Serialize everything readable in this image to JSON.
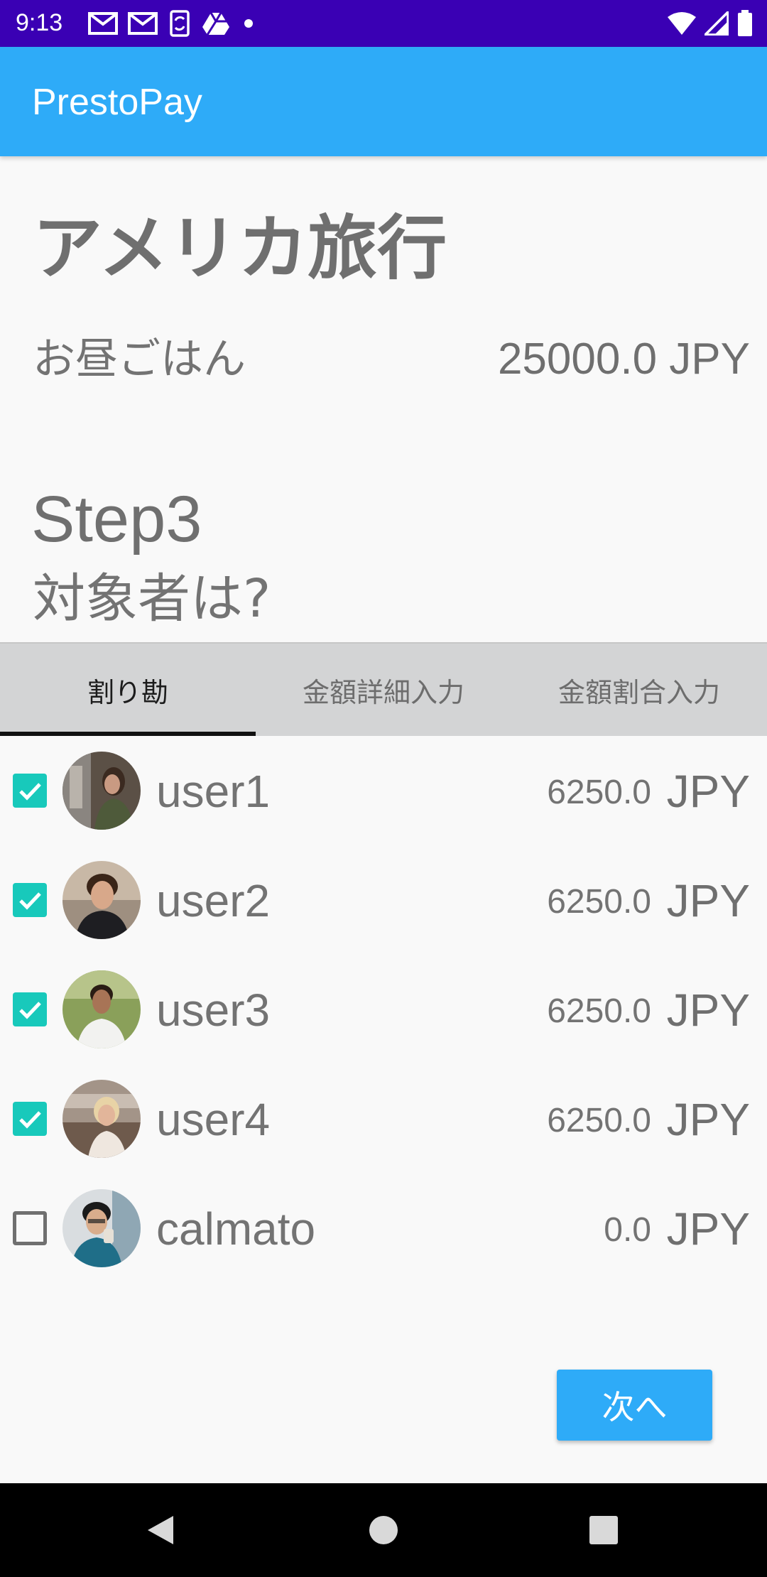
{
  "status_bar": {
    "time": "9:13",
    "left_icons": [
      "gmail-icon",
      "gmail-icon",
      "sync-icon",
      "drive-icon",
      "dot-icon"
    ],
    "right_icons": [
      "wifi-icon",
      "signal-icon",
      "battery-icon"
    ]
  },
  "app_bar": {
    "title": "PrestoPay"
  },
  "trip": {
    "title": "アメリカ旅行"
  },
  "expense": {
    "name": "お昼ごはん",
    "amount": "25000.0 JPY"
  },
  "step": {
    "label": "Step3",
    "question": "対象者は?"
  },
  "tabs": [
    {
      "label": "割り勘",
      "active": true
    },
    {
      "label": "金額詳細入力",
      "active": false
    },
    {
      "label": "金額割合入力",
      "active": false
    }
  ],
  "participants": [
    {
      "name": "user1",
      "amount": "6250.0",
      "currency": "JPY",
      "checked": true
    },
    {
      "name": "user2",
      "amount": "6250.0",
      "currency": "JPY",
      "checked": true
    },
    {
      "name": "user3",
      "amount": "6250.0",
      "currency": "JPY",
      "checked": true
    },
    {
      "name": "user4",
      "amount": "6250.0",
      "currency": "JPY",
      "checked": true
    },
    {
      "name": "calmato",
      "amount": "0.0",
      "currency": "JPY",
      "checked": false
    }
  ],
  "next_button": {
    "label": "次へ"
  },
  "nav_bar": {
    "buttons": [
      "back-icon",
      "home-icon",
      "recents-icon"
    ]
  },
  "colors": {
    "status_bar": "#3a00b4",
    "primary": "#2eabf8",
    "checkbox": "#18c9bb"
  }
}
